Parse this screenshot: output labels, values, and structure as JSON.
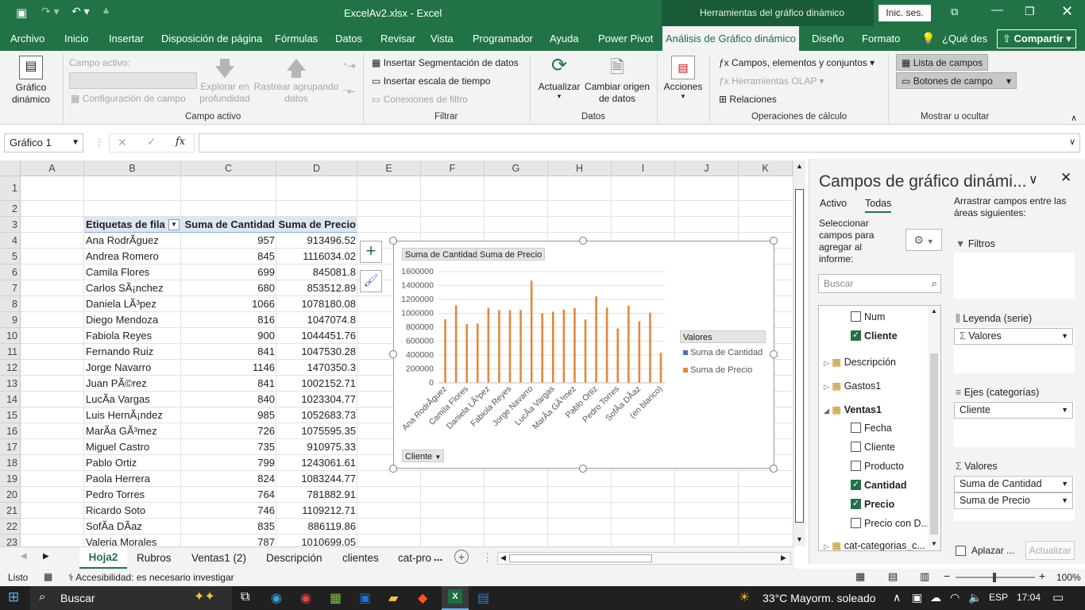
{
  "window": {
    "filename": "ExcelAv2.xlsx - Excel",
    "context_title": "Herramientas del gráfico dinámico",
    "signin": "Inic. ses."
  },
  "ribbon_tabs": [
    "Archivo",
    "Inicio",
    "Insertar",
    "Disposición de página",
    "Fórmulas",
    "Datos",
    "Revisar",
    "Vista",
    "Programador",
    "Ayuda",
    "Power Pivot",
    "Análisis de Gráfico dinámico",
    "Diseño",
    "Formato"
  ],
  "tell_me": "¿Qué des",
  "share": "Compartir",
  "ribbon": {
    "grafico_dinamico": "Gráfico dinámico",
    "campo_activo_label": "Campo activo:",
    "config_campo": "Configuración de campo",
    "explorar": "Explorar en profundidad",
    "rastrear": "Rastrear agrupando datos",
    "group_campo_activo": "Campo activo",
    "insertar_segmentacion": "Insertar Segmentación de datos",
    "insertar_escala": "Insertar escala de tiempo",
    "conexiones_filtro": "Conexiones de filtro",
    "group_filtrar": "Filtrar",
    "actualizar": "Actualizar",
    "cambiar_origen": "Cambiar origen de datos",
    "group_datos": "Datos",
    "acciones": "Acciones",
    "campos_elementos": "Campos, elementos y conjuntos",
    "herramientas_olap": "Herramientas OLAP",
    "relaciones": "Relaciones",
    "group_calculo": "Operaciones de cálculo",
    "lista_campos": "Lista de campos",
    "botones_campo": "Botones de campo",
    "group_mostrar": "Mostrar u ocultar"
  },
  "name_box": "Gráfico 1",
  "fx": "fx",
  "columns": [
    "A",
    "B",
    "C",
    "D",
    "E",
    "F",
    "G",
    "H",
    "I",
    "J",
    "K"
  ],
  "rows": [
    "1",
    "2",
    "3",
    "4",
    "5",
    "6",
    "7",
    "8",
    "9",
    "10",
    "11",
    "12",
    "13",
    "14",
    "15",
    "16",
    "17",
    "18",
    "19",
    "20",
    "21",
    "22",
    "23",
    "24"
  ],
  "pivot": {
    "headers": [
      "Etiquetas de fila",
      "Suma de Cantidad",
      "Suma de Precio"
    ],
    "rows": [
      [
        "Ana RodrÃ­guez",
        "957",
        "913496.52"
      ],
      [
        "Andrea Romero",
        "845",
        "1116034.02"
      ],
      [
        "Camila Flores",
        "699",
        "845081.8"
      ],
      [
        "Carlos SÃ¡nchez",
        "680",
        "853512.89"
      ],
      [
        "Daniela LÃ³pez",
        "1066",
        "1078180.08"
      ],
      [
        "Diego Mendoza",
        "816",
        "1047074.8"
      ],
      [
        "Fabiola Reyes",
        "900",
        "1044451.76"
      ],
      [
        "Fernando Ruiz",
        "841",
        "1047530.28"
      ],
      [
        "Jorge Navarro",
        "1146",
        "1470350.3"
      ],
      [
        "Juan PÃ©rez",
        "841",
        "1002152.71"
      ],
      [
        "LucÃ­a Vargas",
        "840",
        "1023304.77"
      ],
      [
        "Luis HernÃ¡ndez",
        "985",
        "1052683.73"
      ],
      [
        "MarÃ­a GÃ³mez",
        "726",
        "1075595.35"
      ],
      [
        "Miguel Castro",
        "735",
        "910975.33"
      ],
      [
        "Pablo Ortiz",
        "799",
        "1243061.61"
      ],
      [
        "Paola Herrera",
        "824",
        "1083244.77"
      ],
      [
        "Pedro Torres",
        "764",
        "781882.91"
      ],
      [
        "Ricardo Soto",
        "746",
        "1109212.71"
      ],
      [
        "SofÃ­a DÃ­az",
        "835",
        "886119.86"
      ],
      [
        "Valeria Morales",
        "787",
        "1010699.05"
      ],
      [
        "(en blanco)",
        "705",
        "433242.76"
      ]
    ]
  },
  "chart_data": {
    "type": "bar",
    "categories": [
      "Ana RodrÃ­guez",
      "Andrea Romero",
      "Camila Flores",
      "Carlos SÃ¡nchez",
      "Daniela LÃ³pez",
      "Diego Mendoza",
      "Fabiola Reyes",
      "Fernando Ruiz",
      "Jorge Navarro",
      "Juan PÃ©rez",
      "LucÃ­a Vargas",
      "Luis HernÃ¡ndez",
      "MarÃ­a GÃ³mez",
      "Miguel Castro",
      "Pablo Ortiz",
      "Paola Herrera",
      "Pedro Torres",
      "Ricardo Soto",
      "SofÃ­a DÃ­az",
      "Valeria Morales",
      "(en blanco)"
    ],
    "visible_tick_labels": [
      "Ana RodrÃ­guez",
      "Camila Flores",
      "Daniela LÃ³pez",
      "Fabiola Reyes",
      "Jorge Navarro",
      "LucÃ­a Vargas",
      "MarÃ­a GÃ³mez",
      "Pablo Ortiz",
      "Pedro Torres",
      "SofÃ­a DÃ­az",
      "(en blanco)"
    ],
    "series": [
      {
        "name": "Suma de Cantidad",
        "color": "#4472c4",
        "values": [
          957,
          845,
          699,
          680,
          1066,
          816,
          900,
          841,
          1146,
          841,
          840,
          985,
          726,
          735,
          799,
          824,
          764,
          746,
          835,
          787,
          705
        ]
      },
      {
        "name": "Suma de Precio",
        "color": "#e3883a",
        "values": [
          913496.52,
          1116034.02,
          845081.8,
          853512.89,
          1078180.08,
          1047074.8,
          1044451.76,
          1047530.28,
          1470350.3,
          1002152.71,
          1023304.77,
          1052683.73,
          1075595.35,
          910975.33,
          1243061.61,
          1083244.77,
          781882.91,
          1109212.71,
          886119.86,
          1010699.05,
          433242.76
        ]
      }
    ],
    "yticks": [
      "0",
      "200000",
      "400000",
      "600000",
      "800000",
      "1000000",
      "1200000",
      "1400000",
      "1600000"
    ],
    "ylim": [
      0,
      1600000
    ],
    "value_buttons": [
      "Suma de Cantidad",
      "Suma de Precio"
    ],
    "axis_button": "Cliente",
    "legend_title": "Valores",
    "legend_position": "right",
    "grid": true
  },
  "panel": {
    "title": "Campos de gráfico dinámi...",
    "tab_activo": "Activo",
    "tab_todas": "Todas",
    "select_text": "Seleccionar campos para agregar al informe:",
    "drag_text": "Arrastrar campos entre las áreas siguientes:",
    "search_placeholder": "Buscar",
    "fields": [
      {
        "label": "Num",
        "checked": false
      },
      {
        "label": "Cliente",
        "checked": true
      }
    ],
    "tables": [
      "Descripción",
      "Gastos1",
      "Ventas1"
    ],
    "ventas_fields": [
      {
        "label": "Fecha",
        "checked": false
      },
      {
        "label": "Cliente",
        "checked": false
      },
      {
        "label": "Producto",
        "checked": false
      },
      {
        "label": "Cantidad",
        "checked": true
      },
      {
        "label": "Precio",
        "checked": true
      },
      {
        "label": "Precio con D...",
        "checked": false
      }
    ],
    "last_table": "cat-categorias_c...",
    "filtros": "Filtros",
    "leyenda": "Leyenda (serie)",
    "leyenda_value": "Valores",
    "ejes": "Ejes (categorías)",
    "ejes_value": "Cliente",
    "valores": "Valores",
    "valores_items": [
      "Suma de Cantidad",
      "Suma de Precio"
    ],
    "aplazar": "Aplazar ...",
    "actualizar": "Actualizar"
  },
  "sheet_tabs": [
    "Hoja2",
    "Rubros",
    "Ventas1 (2)",
    "Descripción",
    "clientes",
    "cat-pro"
  ],
  "sheet_more": "...",
  "status": {
    "listo": "Listo",
    "accesibilidad": "Accesibilidad: es necesario investigar",
    "zoom": "100%"
  },
  "taskbar": {
    "search": "Buscar",
    "weather": "33°C  Mayorm. soleado",
    "lang": "ESP",
    "time": "17:04"
  }
}
